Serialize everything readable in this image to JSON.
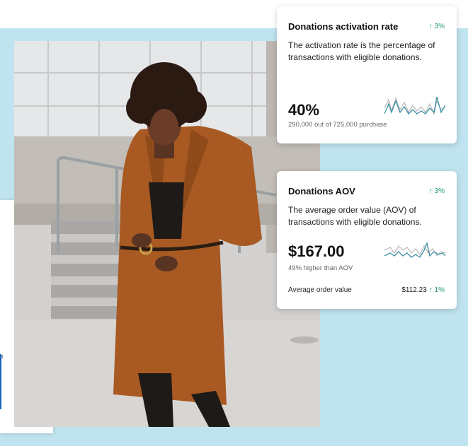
{
  "card_activation": {
    "title": "Donations activation rate",
    "trend": "↑ 3%",
    "description": "The activation rate is the percentage of transactions with eligible donations.",
    "value": "40%",
    "note": "290,000 out of 725,000 purchase"
  },
  "card_aov": {
    "title": "Donations AOV",
    "trend": "↑ 3%",
    "description": "The average order value (AOV) of transactions with eligible donations.",
    "value": "$167.00",
    "note": "49%  higher than AOV",
    "footer_label": "Average order value",
    "footer_value": "$112.23",
    "footer_trend": "↑ 1%"
  },
  "side_card": {
    "fragment": "s"
  },
  "colors": {
    "background": "#bfe3ef",
    "positive": "#1a9a6b",
    "sparkline_primary": "#3a8fa3",
    "sparkline_secondary": "#b8b8b8",
    "coat": "#a85a22"
  }
}
